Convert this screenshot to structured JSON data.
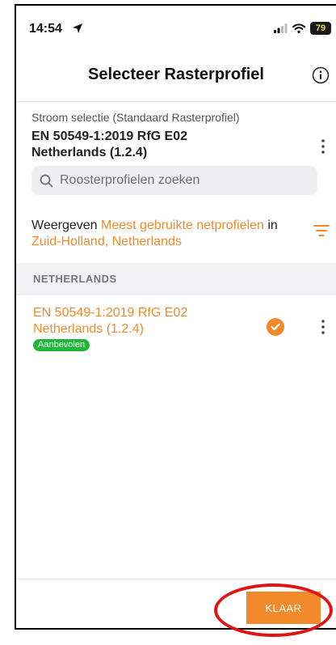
{
  "status_bar": {
    "time": "14:54",
    "battery": "79"
  },
  "header": {
    "title": "Selecteer Rasterprofiel"
  },
  "current": {
    "label": "Stroom selectie (Standaard Rasterprofiel)",
    "name_line1": "EN 50549-1:2019 RfG E02",
    "name_line2": "Netherlands (1.2.4)"
  },
  "search": {
    "placeholder": "Roosterprofielen zoeken",
    "value": ""
  },
  "filter": {
    "prefix": "Weergeven",
    "highlight": "Meest gebruikte netprofielen",
    "in_word": "in",
    "region": "Zuid-Holland, Netherlands"
  },
  "section": {
    "header": "NETHERLANDS"
  },
  "profiles": [
    {
      "name_line1": "EN 50549-1:2019 RfG E02",
      "name_line2": "Netherlands (1.2.4)",
      "badge": "Aanbevolen",
      "selected": true
    }
  ],
  "footer": {
    "done_label": "KLAAR"
  },
  "colors": {
    "accent": "#f28a2c",
    "badge": "#20b63a",
    "annotation": "#e01414"
  },
  "icons": [
    "location-arrow-icon",
    "signal-icon",
    "wifi-icon",
    "battery-icon",
    "info-icon",
    "kebab-menu-icon",
    "search-icon",
    "filter-icon",
    "check-circle-icon"
  ]
}
